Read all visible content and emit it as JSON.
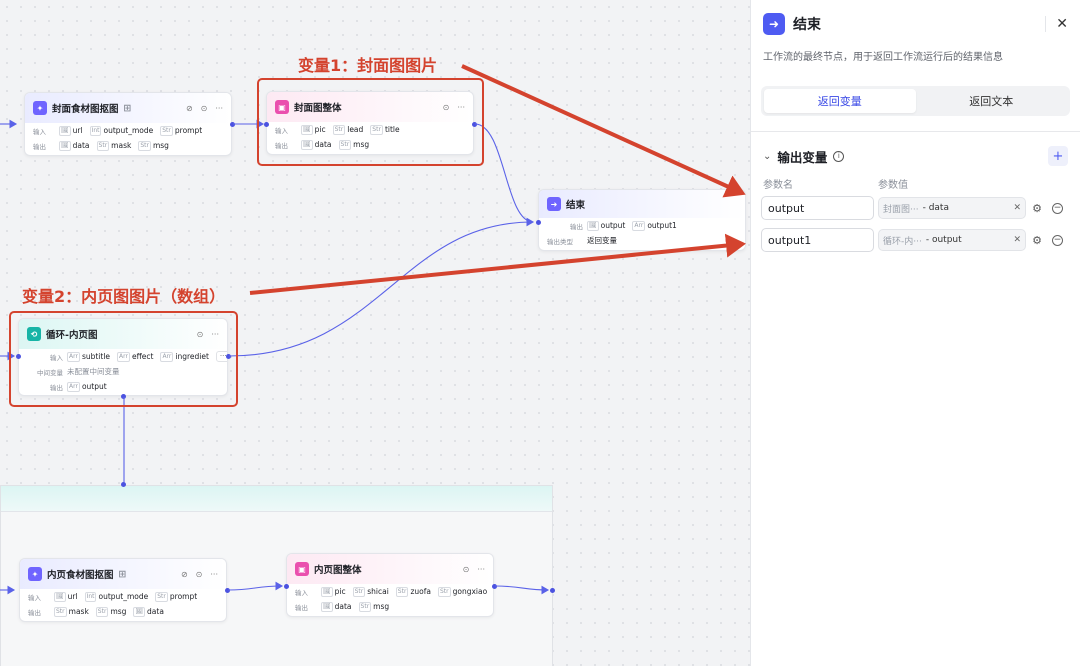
{
  "annotations": {
    "var1": "变量1：封面图图片",
    "var2": "变量2：内页图图片（数组）"
  },
  "labels": {
    "input": "输入",
    "output": "输出",
    "mid": "中间变量",
    "out_type": "输出类型"
  },
  "nodes": {
    "cover_matting": {
      "title": "封面食材图抠图",
      "inputs": [
        {
          "t": "🖼",
          "name": "url"
        },
        {
          "t": "Int",
          "name": "output_mode"
        },
        {
          "t": "Str",
          "name": "prompt"
        }
      ],
      "outputs": [
        {
          "t": "🖼",
          "name": "data"
        },
        {
          "t": "Str",
          "name": "mask"
        },
        {
          "t": "Str",
          "name": "msg"
        }
      ]
    },
    "cover_whole": {
      "title": "封面图整体",
      "inputs": [
        {
          "t": "🖼",
          "name": "pic"
        },
        {
          "t": "Str",
          "name": "lead"
        },
        {
          "t": "Str",
          "name": "title"
        }
      ],
      "outputs": [
        {
          "t": "🖼",
          "name": "data"
        },
        {
          "t": "Str",
          "name": "msg"
        }
      ]
    },
    "end": {
      "title": "结束",
      "outputs": [
        {
          "t": "🖼",
          "name": "output"
        },
        {
          "t": "Arr",
          "name": "output1"
        }
      ],
      "out_type_value": "返回变量"
    },
    "loop": {
      "title": "循环-内页图",
      "inputs": [
        {
          "t": "Arr",
          "name": "subtitle"
        },
        {
          "t": "Arr",
          "name": "effect"
        },
        {
          "t": "Arr",
          "name": "ingrediet"
        }
      ],
      "mid_value": "未配置中间变量",
      "outputs": [
        {
          "t": "Arr",
          "name": "output"
        }
      ]
    },
    "inner_matting": {
      "title": "内页食材图抠图",
      "inputs": [
        {
          "t": "🖼",
          "name": "url"
        },
        {
          "t": "Int",
          "name": "output_mode"
        },
        {
          "t": "Str",
          "name": "prompt"
        }
      ],
      "outputs": [
        {
          "t": "Str",
          "name": "mask"
        },
        {
          "t": "Str",
          "name": "msg"
        },
        {
          "t": "🖼",
          "name": "data"
        }
      ]
    },
    "inner_whole": {
      "title": "内页图整体",
      "inputs": [
        {
          "t": "🖼",
          "name": "pic"
        },
        {
          "t": "Str",
          "name": "shicai"
        },
        {
          "t": "Str",
          "name": "zuofa"
        },
        {
          "t": "Str",
          "name": "gongxiao"
        }
      ],
      "outputs": [
        {
          "t": "🖼",
          "name": "data"
        },
        {
          "t": "Str",
          "name": "msg"
        }
      ]
    }
  },
  "panel": {
    "title": "结束",
    "close": "✕",
    "description": "工作流的最终节点，用于返回工作流运行后的结果信息",
    "tabs": [
      "返回变量",
      "返回文本"
    ],
    "section_title": "输出变量",
    "col_name": "参数名",
    "col_value": "参数值",
    "rows": [
      {
        "name": "output",
        "source": "封面图···",
        "var": "- data"
      },
      {
        "name": "output1",
        "source": "循环-内···",
        "var": "- output"
      }
    ]
  },
  "icons": [
    "magic-icon",
    "image-icon",
    "exit-icon",
    "loop-icon",
    "gear-icon",
    "more-icon",
    "close-icon",
    "plus-icon",
    "minus-icon",
    "info-icon",
    "chevron-down-icon"
  ],
  "colors": {
    "accent": "#4e5bf2",
    "annotation": "#d4432e",
    "edge": "#5a62e8"
  }
}
